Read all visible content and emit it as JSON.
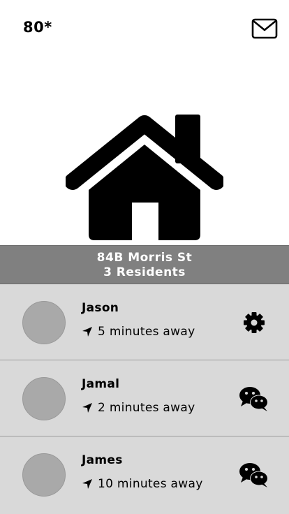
{
  "header": {
    "temperature": "80*",
    "mail_icon": "envelope-icon"
  },
  "home": {
    "icon": "house-icon",
    "address": "84B Morris St",
    "residents_count": "3 Residents"
  },
  "residents": [
    {
      "name": "Jason",
      "distance": "5 minutes away",
      "action_icon": "gear-icon"
    },
    {
      "name": "Jamal",
      "distance": "2 minutes away",
      "action_icon": "chat-icon"
    },
    {
      "name": "James",
      "distance": "10 minutes away",
      "action_icon": "chat-icon"
    }
  ],
  "colors": {
    "address_bar": "#808080",
    "row_background": "#d9d9d9",
    "avatar": "#a9a9a9"
  }
}
